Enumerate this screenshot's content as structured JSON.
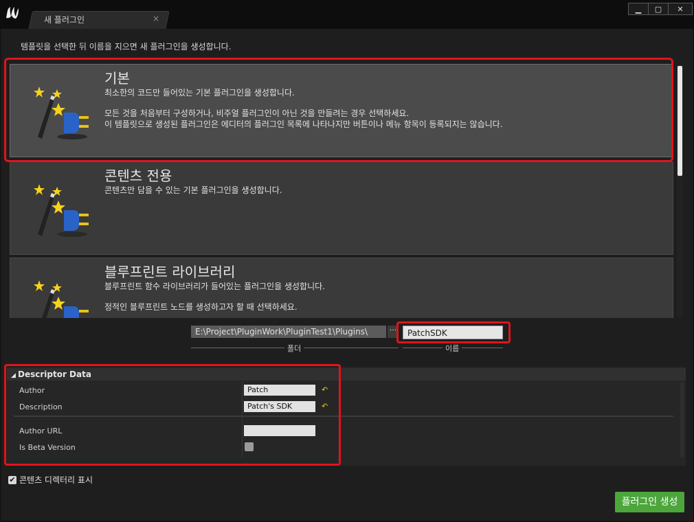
{
  "window": {
    "tab_title": "새 플러그인",
    "tab_close": "×",
    "minimize": "▁",
    "maximize": "▢",
    "close": "✕"
  },
  "instruction": "템플릿을 선택한 뒤 이름을 지으면 새 플러그인을 생성합니다.",
  "templates": [
    {
      "title": "기본",
      "lines": [
        "최소한의 코드만 들어있는 기본 플러그인을 생성합니다.",
        "모든 것을 처음부터 구성하거나, 비주얼 플러그인이 아닌 것을 만들려는 경우 선택하세요.",
        "이 템플릿으로 생성된 플러그인은 에디터의 플러그인 목록에 나타나지만 버튼이나 메뉴 항목이 등록되지는 않습니다."
      ],
      "selected": true
    },
    {
      "title": "콘텐츠 전용",
      "lines": [
        "콘텐츠만 담을 수 있는 기본 플러그인을 생성합니다."
      ],
      "selected": false
    },
    {
      "title": "블루프린트 라이브러리",
      "lines": [
        "블루프린트 함수 라이브러리가 들어있는 플러그인을 생성합니다.",
        "정적인 블루프린트 노드를 생성하고자 할 때 선택하세요."
      ],
      "selected": false
    }
  ],
  "path": {
    "folder_value": "E:\\Project\\PluginWork\\PluginTest1\\Plugins\\",
    "browse_label": "···",
    "name_value": "PatchSDK",
    "folder_caption": "폴더",
    "name_caption": "이름"
  },
  "descriptor": {
    "header": "Descriptor Data",
    "rows": [
      {
        "label": "Author",
        "value": "Patch"
      },
      {
        "label": "Description",
        "value": "Patch's SDK"
      },
      {
        "label": "Author URL",
        "value": ""
      },
      {
        "label": "Is Beta Version",
        "value": ""
      }
    ],
    "reset_icon": "↶"
  },
  "show_content_dir": {
    "label": "콘텐츠 디렉터리 표시",
    "checked": true,
    "check_glyph": "✔"
  },
  "create_button": "플러그인 생성",
  "colors": {
    "annotation": "#e0141d",
    "create": "#4ca63c",
    "reset": "#e8c21a"
  }
}
